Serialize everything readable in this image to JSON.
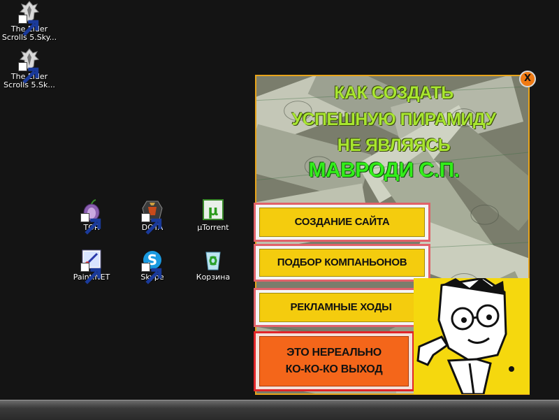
{
  "desktop": {
    "icons": [
      {
        "name": "skyrim-1",
        "label": "The Elder\nScrolls 5.Sky..."
      },
      {
        "name": "skyrim-2",
        "label": "The Elder\nScrolls 5.Sk..."
      },
      {
        "name": "tor",
        "label": "TOR"
      },
      {
        "name": "dota",
        "label": "DOTA"
      },
      {
        "name": "utorrent",
        "label": "µTorrent"
      },
      {
        "name": "paintnet",
        "label": "Paint.NET"
      },
      {
        "name": "skype",
        "label": "Skype"
      },
      {
        "name": "recycle-bin",
        "label": "Корзина"
      }
    ]
  },
  "popup": {
    "close_label": "X",
    "headline": [
      "КАК СОЗДАТЬ",
      "УСПЕШНУЮ ПИРАМИДУ",
      "НЕ ЯВЛЯЯСЬ",
      "МАВРОДИ С.П."
    ],
    "buttons": [
      {
        "label": "СОЗДАНИЕ САЙТА"
      },
      {
        "label": "ПОДБОР КОМПАНЬОНОВ"
      },
      {
        "label": "РЕКЛАМНЫЕ ХОДЫ"
      },
      {
        "label": "ЭТО НЕРЕАЛЬНО\nКО-КО-КО ВЫХОД"
      }
    ]
  },
  "colors": {
    "desktop_bg": "#141414",
    "popup_border": "#e8a41a",
    "headline_green": "#a8e630",
    "headline_bright_green": "#33ee1a",
    "button_yellow": "#f4cc0e",
    "button_orange": "#f4661a",
    "button_frame_pink": "#e0626a",
    "close_orange": "#f07a12"
  }
}
